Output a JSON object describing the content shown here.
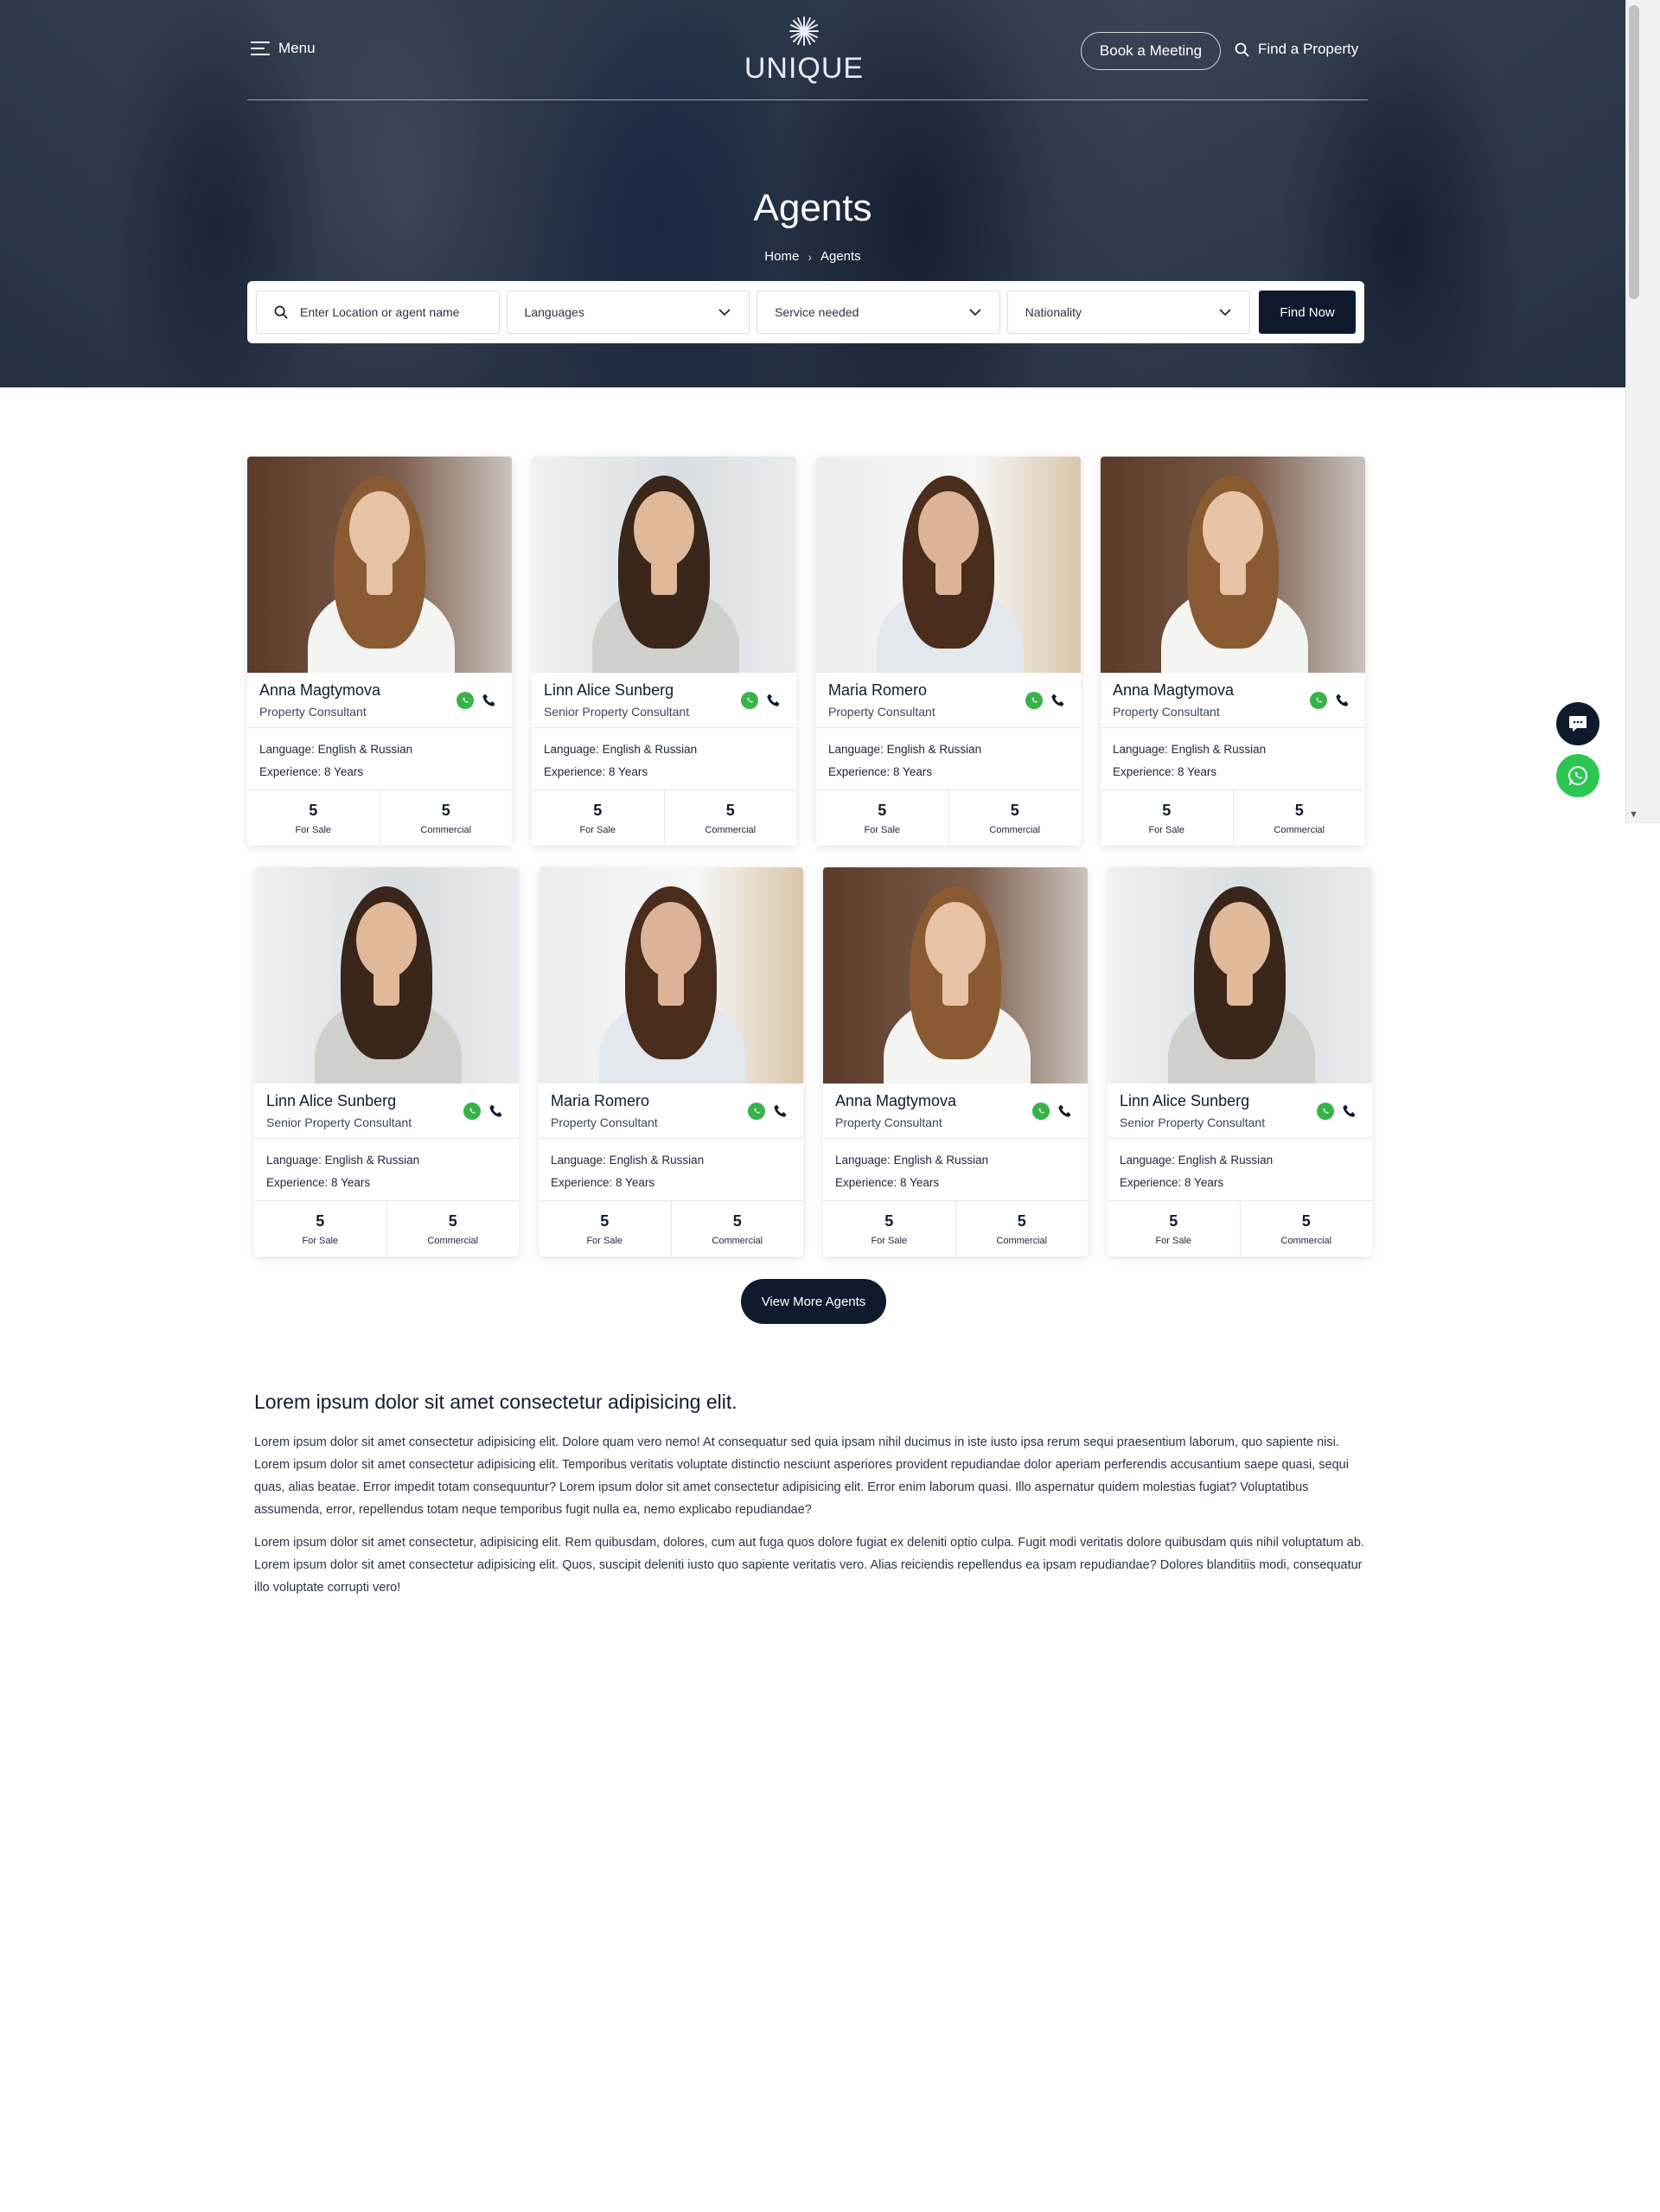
{
  "header": {
    "menu_label": "Menu",
    "logo_text": "UNIQUE",
    "book_meeting_label": "Book a Meeting",
    "find_property_label": "Find a Property"
  },
  "hero": {
    "title": "Agents",
    "breadcrumb": [
      "Home",
      "Agents"
    ]
  },
  "search": {
    "placeholder": "Enter Location or agent name",
    "languages_label": "Languages",
    "service_label": "Service needed",
    "nationality_label": "Nationality",
    "submit_label": "Find Now"
  },
  "agents": [
    {
      "name": "Anna Magtymova",
      "role": "Property Consultant",
      "language": "Language: English & Russian",
      "experience": "Experience: 8 Years",
      "for_sale": "5",
      "for_sale_label": "For Sale",
      "commercial": "5",
      "commercial_label": "Commercial"
    },
    {
      "name": "Linn Alice Sunberg",
      "role": "Senior Property Consultant",
      "language": "Language: English & Russian",
      "experience": "Experience: 8 Years",
      "for_sale": "5",
      "for_sale_label": "For Sale",
      "commercial": "5",
      "commercial_label": "Commercial"
    },
    {
      "name": "Maria Romero",
      "role": "Property Consultant",
      "language": "Language: English & Russian",
      "experience": "Experience: 8 Years",
      "for_sale": "5",
      "for_sale_label": "For Sale",
      "commercial": "5",
      "commercial_label": "Commercial"
    },
    {
      "name": "Anna Magtymova",
      "role": "Property Consultant",
      "language": "Language: English & Russian",
      "experience": "Experience: 8 Years",
      "for_sale": "5",
      "for_sale_label": "For Sale",
      "commercial": "5",
      "commercial_label": "Commercial"
    },
    {
      "name": "Linn Alice Sunberg",
      "role": "Senior Property Consultant",
      "language": "Language: English & Russian",
      "experience": "Experience: 8 Years",
      "for_sale": "5",
      "for_sale_label": "For Sale",
      "commercial": "5",
      "commercial_label": "Commercial"
    },
    {
      "name": "Maria Romero",
      "role": "Property Consultant",
      "language": "Language: English & Russian",
      "experience": "Experience: 8 Years",
      "for_sale": "5",
      "for_sale_label": "For Sale",
      "commercial": "5",
      "commercial_label": "Commercial"
    },
    {
      "name": "Anna Magtymova",
      "role": "Property Consultant",
      "language": "Language: English & Russian",
      "experience": "Experience: 8 Years",
      "for_sale": "5",
      "for_sale_label": "For Sale",
      "commercial": "5",
      "commercial_label": "Commercial"
    },
    {
      "name": "Linn Alice Sunberg",
      "role": "Senior Property Consultant",
      "language": "Language: English & Russian",
      "experience": "Experience: 8 Years",
      "for_sale": "5",
      "for_sale_label": "For Sale",
      "commercial": "5",
      "commercial_label": "Commercial"
    }
  ],
  "view_more_label": "View More Agents",
  "content": {
    "heading": "Lorem ipsum dolor sit amet consectetur adipisicing elit.",
    "paragraphs": [
      "Lorem ipsum dolor sit amet consectetur adipisicing elit. Dolore quam vero nemo! At consequatur sed quia ipsam nihil ducimus in iste iusto ipsa rerum sequi praesentium laborum, quo sapiente nisi. Lorem ipsum dolor sit amet consectetur adipisicing elit. Temporibus veritatis voluptate distinctio nesciunt asperiores provident repudiandae dolor aperiam perferendis accusantium saepe quasi, sequi quas, alias beatae. Error impedit totam consequuntur? Lorem ipsum dolor sit amet consectetur adipisicing elit. Error enim laborum quasi. Illo aspernatur quidem molestias fugiat? Voluptatibus assumenda, error, repellendus totam neque temporibus fugit nulla ea, nemo explicabo repudiandae?",
      "Lorem ipsum dolor sit amet consectetur, adipisicing elit. Rem quibusdam, dolores, cum aut fuga quos dolore fugiat ex deleniti optio culpa. Fugit modi veritatis dolore quibusdam quis nihil voluptatum ab. Lorem ipsum dolor sit amet consectetur adipisicing elit. Quos, suscipit deleniti iusto quo sapiente veritatis vero. Alias reiciendis repellendus ea ipsam repudiandae? Dolores blanditiis modi, consequatur illo voluptate corrupti vero!"
    ]
  },
  "colors": {
    "navy": "#0f1b2d",
    "whatsapp_green": "#2dc653",
    "hero_overlay": "#172237"
  }
}
